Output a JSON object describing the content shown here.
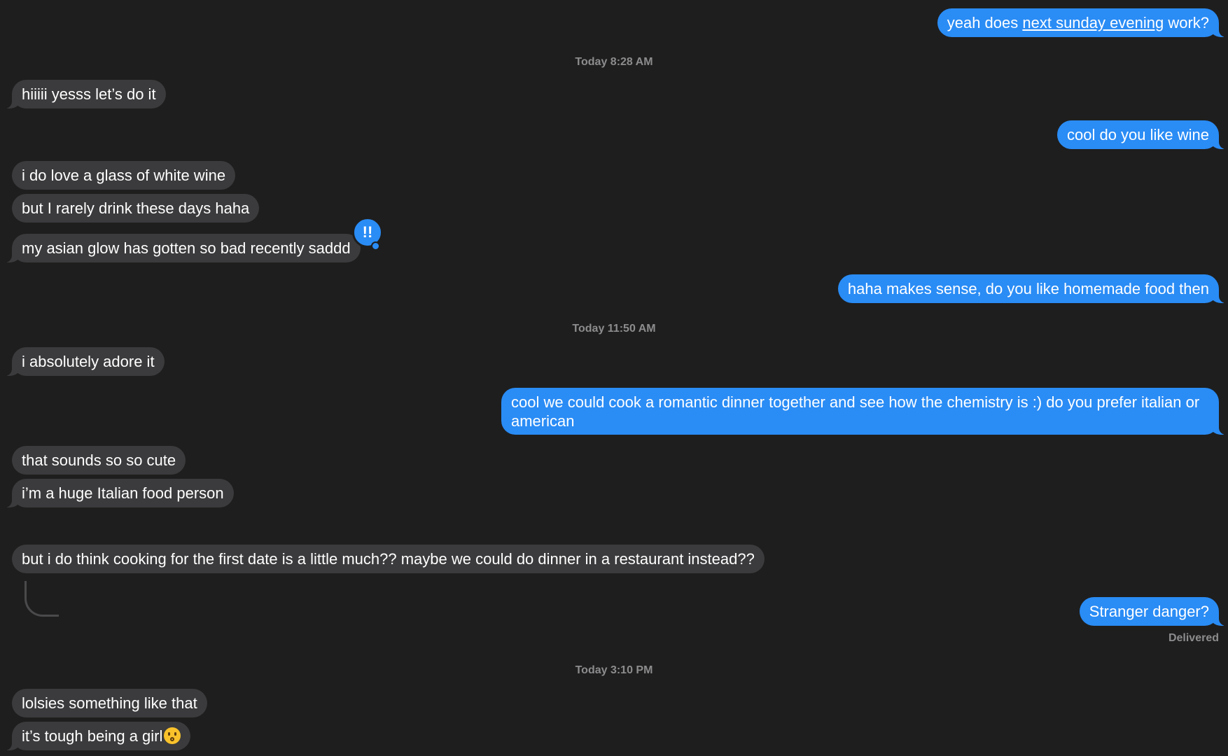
{
  "conversation": {
    "messages": [
      {
        "id": "m1",
        "text_parts": [
          "yeah does ",
          "next sunday evening",
          " work?"
        ]
      },
      {
        "id": "m2",
        "text": "hiiiii yesss let’s do it"
      },
      {
        "id": "m3",
        "text": "cool do you like wine"
      },
      {
        "id": "m4",
        "text": "i do love a glass of white wine"
      },
      {
        "id": "m5",
        "text": "but I rarely drink these days haha"
      },
      {
        "id": "m6",
        "text": "my asian glow has gotten so bad recently saddd",
        "reaction": "!!"
      },
      {
        "id": "m7",
        "text": "haha makes sense, do you like homemade food then"
      },
      {
        "id": "m8",
        "text": "i absolutely adore it"
      },
      {
        "id": "m9",
        "text": "cool we could cook a romantic dinner together and see how the chemistry is :) do you prefer italian or american"
      },
      {
        "id": "m10",
        "text": "that sounds so so cute"
      },
      {
        "id": "m11",
        "text": "i’m a huge Italian food person"
      },
      {
        "id": "m12",
        "text": "but i do think cooking for the first date is a little much?? maybe we could do dinner in a restaurant instead??"
      },
      {
        "id": "m13",
        "text": "Stranger danger?",
        "status": "Delivered"
      },
      {
        "id": "m14",
        "text": "lolsies something like that"
      },
      {
        "id": "m15",
        "text": "it’s tough being a girl",
        "emoji": "face-with-hand-over-mouth"
      }
    ],
    "timestamps": [
      "Today 8:28 AM",
      "Today 11:50 AM",
      "Today 3:10 PM"
    ]
  },
  "colors": {
    "background": "#1e1e1e",
    "incoming_bubble": "#3b3b3d",
    "outgoing_bubble": "#2a8cf5",
    "meta_text": "#8c8c8e"
  }
}
